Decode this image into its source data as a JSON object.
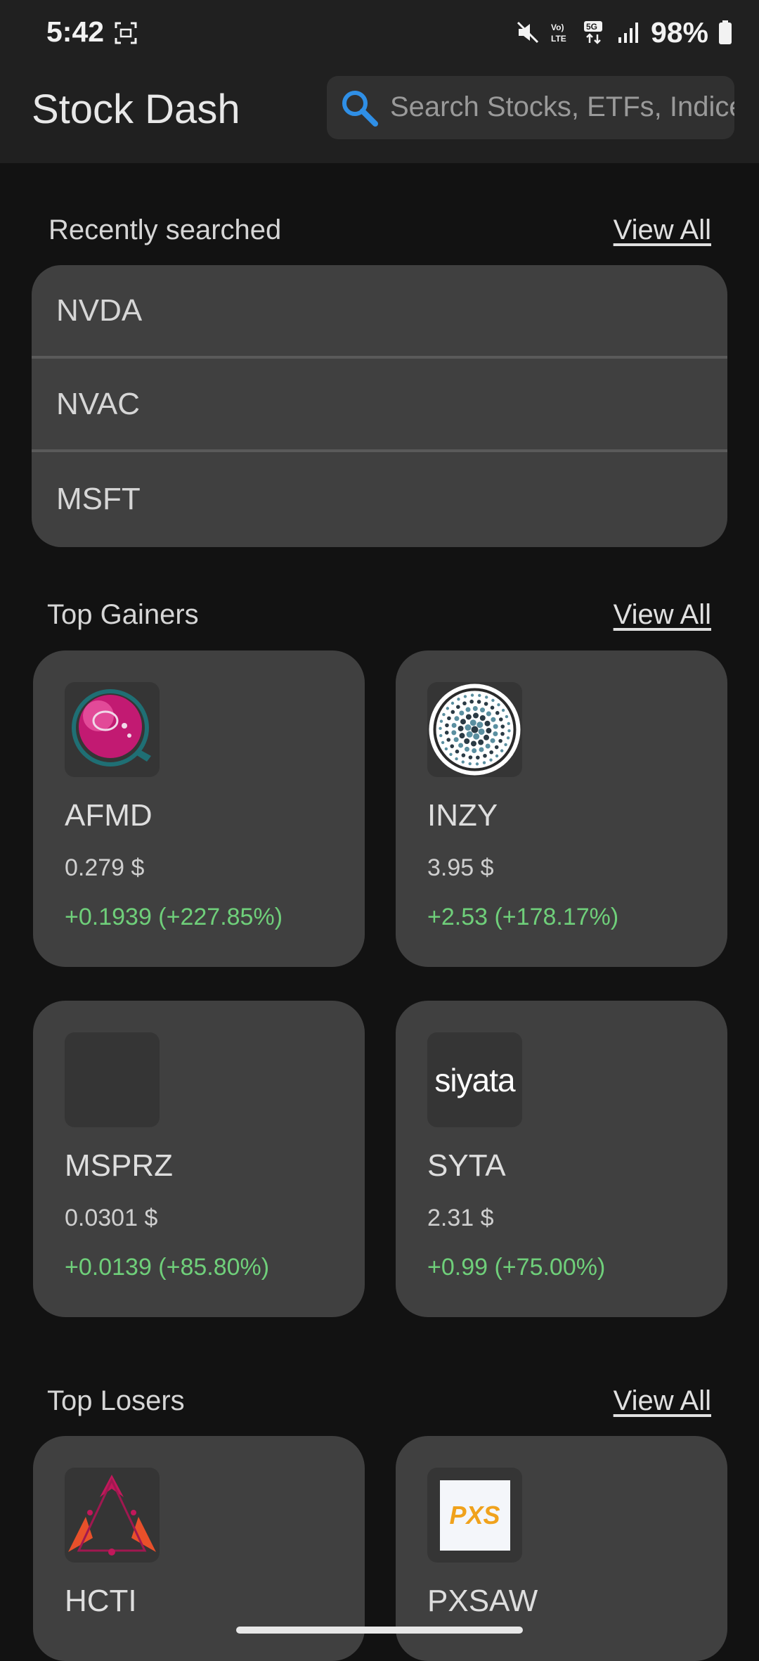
{
  "status_bar": {
    "time": "5:42",
    "battery": "98%",
    "network": "5G",
    "volte": "Vo) LTE"
  },
  "app_bar": {
    "title": "Stock Dash",
    "search_placeholder": "Search Stocks, ETFs, Indices"
  },
  "recent": {
    "title": "Recently searched",
    "view_all": "View All",
    "items": [
      "NVDA",
      "NVAC",
      "MSFT"
    ]
  },
  "gainers": {
    "title": "Top Gainers",
    "view_all": "View All",
    "cards": [
      {
        "symbol": "AFMD",
        "price": "0.279 $",
        "change": "+0.1939 (+227.85%)",
        "logo": "afmd-logo"
      },
      {
        "symbol": "INZY",
        "price": "3.95 $",
        "change": "+2.53 (+178.17%)",
        "logo": "inzy-logo"
      },
      {
        "symbol": "MSPRZ",
        "price": "0.0301 $",
        "change": "+0.0139 (+85.80%)",
        "logo": "blank-logo"
      },
      {
        "symbol": "SYTA",
        "price": "2.31 $",
        "change": "+0.99 (+75.00%)",
        "logo": "siyata-logo",
        "logo_text": "siyata"
      }
    ]
  },
  "losers": {
    "title": "Top Losers",
    "view_all": "View All",
    "cards": [
      {
        "symbol": "HCTI",
        "logo": "hcti-logo"
      },
      {
        "symbol": "PXSAW",
        "logo": "pxs-logo",
        "logo_text": "PXS"
      }
    ]
  },
  "colors": {
    "background": "#121212",
    "card": "#404040",
    "gain": "#6fcf7a",
    "accent": "#2f8fe6"
  }
}
